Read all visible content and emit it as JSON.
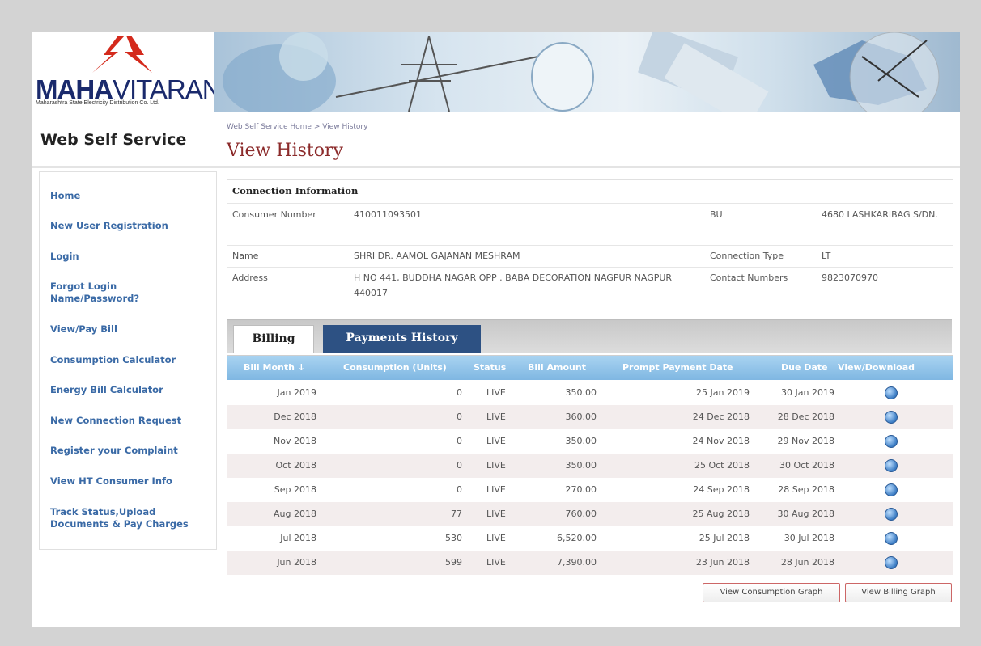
{
  "brand": {
    "name_bold": "MAHA",
    "name_light": "VITARAN",
    "subtitle": "Maharashtra State Electricity Distribution Co. Ltd.",
    "colors": {
      "logo_red": "#d42a1c",
      "logo_blue": "#1a2a6c"
    }
  },
  "header": {
    "site_title": "Web Self Service",
    "breadcrumb": "Web Self Service Home > View History",
    "page_title": "View History"
  },
  "sidebar": {
    "items": [
      {
        "label": "Home"
      },
      {
        "label": "New User Registration"
      },
      {
        "label": "Login"
      },
      {
        "label": "Forgot Login Name/Password?"
      },
      {
        "label": "View/Pay Bill"
      },
      {
        "label": "Consumption Calculator"
      },
      {
        "label": "Energy Bill Calculator"
      },
      {
        "label": "New Connection Request"
      },
      {
        "label": "Register your Complaint"
      },
      {
        "label": "View HT Consumer Info"
      },
      {
        "label": "Track Status,Upload Documents & Pay Charges"
      }
    ]
  },
  "connection": {
    "heading": "Connection Information",
    "consumer_number_label": "Consumer Number",
    "consumer_number": "410011093501",
    "bu_label": "BU",
    "bu": "4680 LASHKARIBAG S/DN.",
    "name_label": "Name",
    "name": "SHRI DR. AAMOL GAJANAN MESHRAM",
    "connection_type_label": "Connection Type",
    "connection_type": "LT",
    "address_label": "Address",
    "address": "H NO 441, BUDDHA NAGAR OPP . BABA DECORATION NAGPUR NAGPUR 440017",
    "contact_label": "Contact Numbers",
    "contact": "9823070970"
  },
  "tabs": {
    "billing": "Billing",
    "payments": "Payments History"
  },
  "table": {
    "columns": [
      "Bill Month ↓",
      "Consumption (Units)",
      "Status",
      "Bill Amount",
      "Prompt Payment Date",
      "Due Date",
      "View/Download"
    ],
    "rows": [
      {
        "month": "Jan 2019",
        "units": "0",
        "status": "LIVE",
        "amount": "350.00",
        "prompt": "25 Jan 2019",
        "due": "30 Jan 2019"
      },
      {
        "month": "Dec 2018",
        "units": "0",
        "status": "LIVE",
        "amount": "360.00",
        "prompt": "24 Dec 2018",
        "due": "28 Dec 2018"
      },
      {
        "month": "Nov 2018",
        "units": "0",
        "status": "LIVE",
        "amount": "350.00",
        "prompt": "24 Nov 2018",
        "due": "29 Nov 2018"
      },
      {
        "month": "Oct 2018",
        "units": "0",
        "status": "LIVE",
        "amount": "350.00",
        "prompt": "25 Oct 2018",
        "due": "30 Oct 2018"
      },
      {
        "month": "Sep 2018",
        "units": "0",
        "status": "LIVE",
        "amount": "270.00",
        "prompt": "24 Sep 2018",
        "due": "28 Sep 2018"
      },
      {
        "month": "Aug 2018",
        "units": "77",
        "status": "LIVE",
        "amount": "760.00",
        "prompt": "25 Aug 2018",
        "due": "30 Aug 2018"
      },
      {
        "month": "Jul 2018",
        "units": "530",
        "status": "LIVE",
        "amount": "6,520.00",
        "prompt": "25 Jul 2018",
        "due": "30 Jul 2018"
      },
      {
        "month": "Jun 2018",
        "units": "599",
        "status": "LIVE",
        "amount": "7,390.00",
        "prompt": "23 Jun 2018",
        "due": "28 Jun 2018"
      }
    ]
  },
  "buttons": {
    "consumption_graph": "View Consumption Graph",
    "billing_graph": "View Billing Graph"
  }
}
